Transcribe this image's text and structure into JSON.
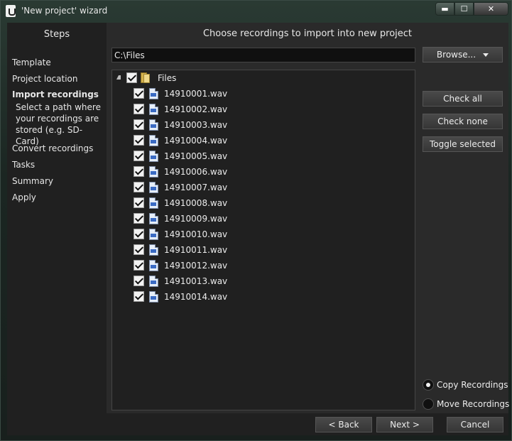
{
  "window": {
    "title": "'New project' wizard",
    "controls": {
      "minimize": "▬",
      "maximize": "☐",
      "close": "✕"
    }
  },
  "steps": {
    "title": "Steps",
    "items": [
      {
        "label": "Template"
      },
      {
        "label": "Project location"
      },
      {
        "label": "Import recordings"
      },
      {
        "label": "Convert recordings"
      },
      {
        "label": "Tasks"
      },
      {
        "label": "Summary"
      },
      {
        "label": "Apply"
      }
    ],
    "active_description": "Select a path where your recordings are stored (e.g. SD-Card)"
  },
  "main": {
    "title": "Choose recordings to import into new project",
    "path_value": "C:\\Files",
    "browse_label": "Browse...",
    "check_all_label": "Check all",
    "check_none_label": "Check none",
    "toggle_selected_label": "Toggle selected",
    "tree": {
      "root": {
        "label": "Files",
        "checked": true,
        "expanded": true
      },
      "files": [
        {
          "label": "14910001.wav",
          "checked": true
        },
        {
          "label": "14910002.wav",
          "checked": true
        },
        {
          "label": "14910003.wav",
          "checked": true
        },
        {
          "label": "14910004.wav",
          "checked": true
        },
        {
          "label": "14910005.wav",
          "checked": true
        },
        {
          "label": "14910006.wav",
          "checked": true
        },
        {
          "label": "14910007.wav",
          "checked": true
        },
        {
          "label": "14910008.wav",
          "checked": true
        },
        {
          "label": "14910009.wav",
          "checked": true
        },
        {
          "label": "14910010.wav",
          "checked": true
        },
        {
          "label": "14910011.wav",
          "checked": true
        },
        {
          "label": "14910012.wav",
          "checked": true
        },
        {
          "label": "14910013.wav",
          "checked": true
        },
        {
          "label": "14910014.wav",
          "checked": true
        }
      ]
    },
    "options": {
      "copy_label": "Copy Recordings",
      "move_label": "Move Recordings",
      "selected": "copy"
    }
  },
  "footer": {
    "back_label": "< Back",
    "next_label": "Next >",
    "cancel_label": "Cancel"
  }
}
